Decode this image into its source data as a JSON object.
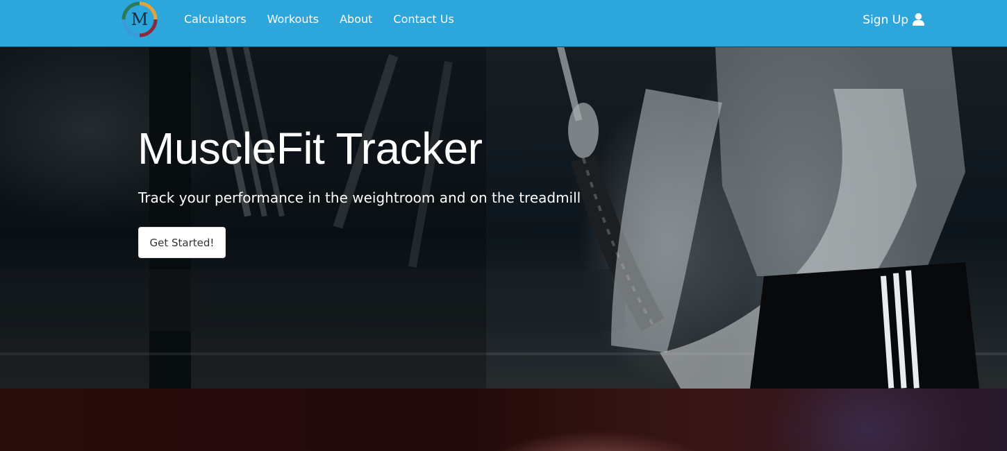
{
  "brand": {
    "logo_letter": "M",
    "colors": {
      "nav": "#2da6dc",
      "logo_segments": [
        "#e3a33b",
        "#3a9ad9",
        "#8a2a3a",
        "#2c7a5a"
      ]
    }
  },
  "nav": {
    "links": [
      {
        "label": "Calculators"
      },
      {
        "label": "Workouts"
      },
      {
        "label": "About"
      },
      {
        "label": "Contact Us"
      }
    ],
    "signup_label": "Sign Up",
    "signup_icon": "user-icon"
  },
  "hero": {
    "title": "MuscleFit Tracker",
    "subtitle": "Track your performance in the weightroom and on the treadmill",
    "cta_label": "Get Started!"
  }
}
